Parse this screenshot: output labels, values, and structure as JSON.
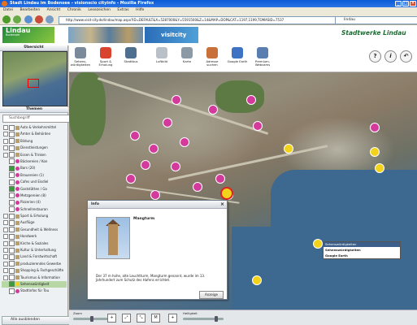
{
  "browser": {
    "window_title": "Stadt Lindau im Bodensee - visionscio cityinfo - Mozilla Firefox",
    "menu": [
      "Datei",
      "Bearbeiten",
      "Ansicht",
      "Chronik",
      "Lesezeichen",
      "Extras",
      "Hilfe"
    ],
    "url": "http://www.visit-city.de/lindau/map.aspx?ID=DEFAULT&X=5287000&Y=5591500&Z=14&MAP=DOP&CAT=1197,1199,TOMASID=7537",
    "search_value": "lindau"
  },
  "header": {
    "logo_text": "Lindau",
    "logo_sub": "Bodensee",
    "visitcity": "visitcity",
    "stadtwerke": "Stadtwerke Lindau"
  },
  "left_panel": {
    "overview_title": "Übersicht",
    "themes_title": "Themen",
    "search_placeholder": "Suchbegriff",
    "tree": [
      {
        "label": "Auto & Verkehrsmittel",
        "level": 1
      },
      {
        "label": "Ämter & Behörden",
        "level": 1
      },
      {
        "label": "Bildung",
        "level": 1
      },
      {
        "label": "Dienstleistungen",
        "level": 1
      },
      {
        "label": "Essen & Trinken",
        "level": 1
      },
      {
        "label": "Bäckereien / Kon",
        "level": 2
      },
      {
        "label": "Bars (20)",
        "level": 2,
        "checked": true
      },
      {
        "label": "Brauereien (1)",
        "level": 2
      },
      {
        "label": "Cafes und Eisdiel",
        "level": 2
      },
      {
        "label": "Gaststätten / Ga",
        "level": 2,
        "checked": true
      },
      {
        "label": "Metzgereien (8)",
        "level": 2
      },
      {
        "label": "Pizzerien (4)",
        "level": 2
      },
      {
        "label": "Schnellrestauran",
        "level": 2
      },
      {
        "label": "Sport & Erholung",
        "level": 1
      },
      {
        "label": "Ausflüge",
        "level": 1
      },
      {
        "label": "Gesundheit & Wellness",
        "level": 1
      },
      {
        "label": "Handwerk",
        "level": 1
      },
      {
        "label": "Kirche & Soziales",
        "level": 1
      },
      {
        "label": "Kultur & Unterhaltung",
        "level": 1
      },
      {
        "label": "Land & Forstwirtschaft",
        "level": 1
      },
      {
        "label": "produzierendes Gewerbe",
        "level": 1
      },
      {
        "label": "Shopping & Fachgeschäfte",
        "level": 1
      },
      {
        "label": "Tourismus & Information",
        "level": 1
      },
      {
        "label": "Sehenswürdigkeit",
        "level": 2,
        "checked": true,
        "highlight": true
      },
      {
        "label": "Stadtinfos für Tou",
        "level": 2
      }
    ],
    "deselect_all": "Alle ausblenden"
  },
  "toolbar": {
    "tools": [
      {
        "label": "Sehens-würdigkeiten",
        "icon": "camera-icon",
        "color": "#7a8a9a"
      },
      {
        "label": "Sport & Erholung",
        "icon": "sport-icon",
        "color": "#d8442e"
      },
      {
        "label": "Stadtbus",
        "icon": "bus-icon",
        "color": "#4f6f8f"
      },
      {
        "label": "Luftbild",
        "icon": "aerial-icon",
        "color": "#b9c0c8"
      },
      {
        "label": "Karte",
        "icon": "map-icon",
        "color": "#8c9aa6"
      },
      {
        "label": "Adresse suchen",
        "icon": "address-search-icon",
        "color": "#c96f3a"
      },
      {
        "label": "Google Earth",
        "icon": "google-earth-icon",
        "color": "#3d73c2"
      },
      {
        "label": "Premium-Webcams",
        "icon": "webcam-icon",
        "color": "#5a7eb0"
      }
    ],
    "right_buttons": [
      "?",
      "i",
      "↶"
    ]
  },
  "popup": {
    "header": "Info",
    "title": "Mangturm",
    "description": "Der 37 m hohe, alte Leuchtturm, Mangturm genannt, wurde im 13. Jahrhundert zum Schutz des Hafens errichtet.",
    "close_label": "Anzeige",
    "close_x": "×"
  },
  "context_menu": {
    "header": "Sehenswürdigkeiten",
    "items": [
      "Sehenswürdigkeiten",
      "Google Earth"
    ]
  },
  "zoom": {
    "zoom_label": "Zoom",
    "brightness_label": "Helligkeit",
    "zoom_level": 0.45,
    "brightness_level": 0.85
  }
}
